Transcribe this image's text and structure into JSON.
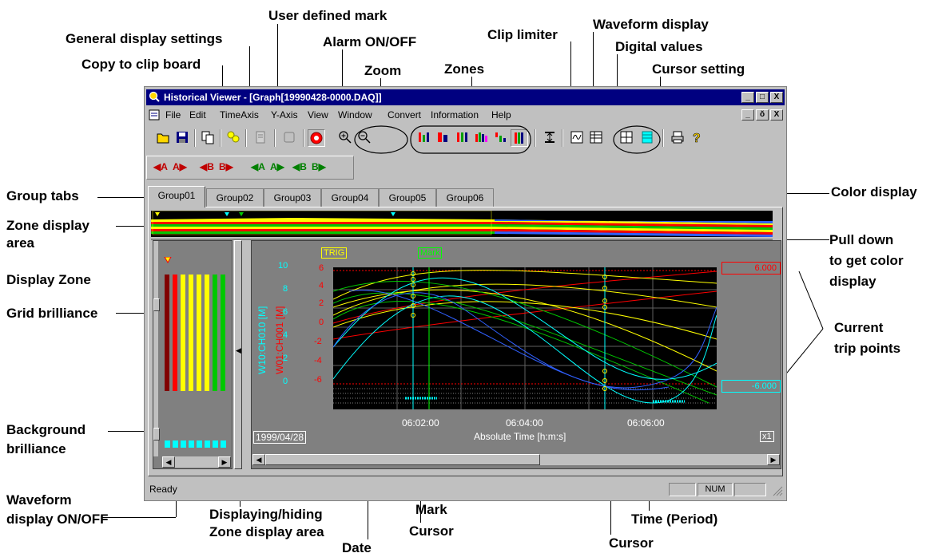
{
  "annotations": {
    "user_defined_mark": "User defined mark",
    "general_display_settings": "General display settings",
    "alarm_on_off": "Alarm ON/OFF",
    "copy_to_clip_board": "Copy to clip board",
    "zoom": "Zoom",
    "zones": "Zones",
    "clip_limiter": "Clip limiter",
    "waveform_display": "Waveform display",
    "digital_values": "Digital values",
    "cursor_setting": "Cursor setting",
    "group_tabs": "Group tabs",
    "color_display": "Color display",
    "zone_display_area_1": "Zone display",
    "zone_display_area_2": "area",
    "pull_down_1": "Pull down",
    "pull_down_2": "to get color",
    "pull_down_3": "display",
    "display_zone": "Display Zone",
    "grid_brilliance": "Grid brilliance",
    "current_trip_points_1": "Current",
    "current_trip_points_2": "trip points",
    "background_brilliance_1": "Background",
    "background_brilliance_2": "brilliance",
    "waveform_on_off_1": "Waveform",
    "waveform_on_off_2": "display ON/OFF",
    "displaying_hiding_1": "Displaying/hiding",
    "displaying_hiding_2": "Zone display area",
    "mark": "Mark",
    "cursor_1": "Cursor",
    "cursor_2": "Cursor",
    "time_period": "Time (Period)",
    "date": "Date"
  },
  "window": {
    "title": "Historical Viewer - [Graph[19990428-0000.DAQ]]",
    "min_label": "_",
    "max_label": "□",
    "close_label": "X",
    "child_max_label": "ŏ"
  },
  "menu": [
    "File",
    "Edit",
    "TimeAxis",
    "Y-Axis",
    "View",
    "Window",
    "Convert",
    "Information",
    "Help"
  ],
  "toolbar2": [
    "A",
    "A",
    "B",
    "B",
    "A",
    "A",
    "B",
    "B"
  ],
  "tabs": [
    "Group01",
    "Group02",
    "Group03",
    "Group04",
    "Group05",
    "Group06"
  ],
  "graph": {
    "trig_label": "TRIG",
    "mark_label": "Mark",
    "axis_label_1": "W10:CH010 [M]",
    "axis_label_2": "W01:CH001 [M]",
    "ticks_cyan": [
      "10",
      "8",
      "6",
      "4",
      "2",
      "0"
    ],
    "ticks_red": [
      "6",
      "4",
      "2",
      "0",
      "-2",
      "-4",
      "-6"
    ],
    "trip_high": "6.000",
    "trip_low": "-6.000",
    "x_ticks": [
      "06:02:00",
      "06:04:00",
      "06:06:00"
    ],
    "x_label": "Absolute Time [h:m:s]",
    "date": "1999/04/28",
    "scale": "x1"
  },
  "status": {
    "text": "Ready",
    "num": "NUM"
  },
  "colors": {
    "title_bg": "#000080",
    "window_bg": "#c0c0c0",
    "plot_bg": "#000000",
    "red": "#ff0000",
    "yellow": "#ffff00",
    "green": "#00c800",
    "cyan": "#00ffff",
    "blue": "#3060ff"
  }
}
